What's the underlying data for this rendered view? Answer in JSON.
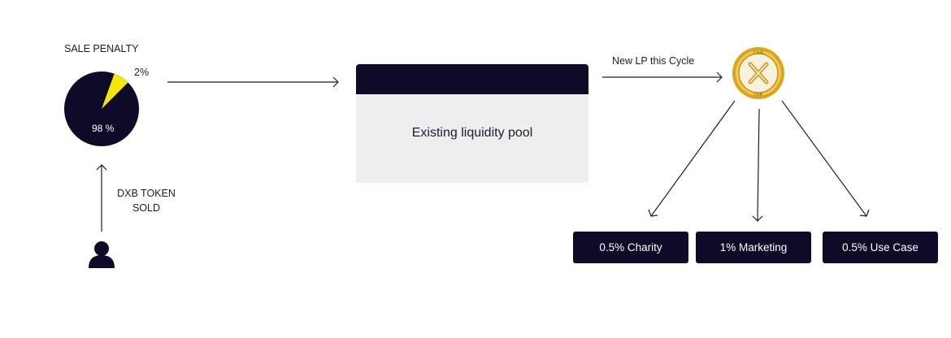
{
  "penalty": {
    "title": "SALE PENALTY",
    "slices": [
      {
        "label": "98 %",
        "value": 98,
        "color": "#0d0b27"
      },
      {
        "label": "2%",
        "value": 2,
        "color": "#f5e60a"
      }
    ]
  },
  "user": {
    "action_line1": "DXB TOKEN",
    "action_line2": "SOLD",
    "icon": "user-icon"
  },
  "pool": {
    "label": "Existing liquidity pool",
    "header_color": "#0d0b27",
    "body_color": "#eeeeee"
  },
  "lp": {
    "label": "New LP this Cycle",
    "coin_icon": "dxb-coin-logo",
    "coin_text": "DXB"
  },
  "allocations": [
    {
      "label": "0.5% Charity"
    },
    {
      "label": "1% Marketing"
    },
    {
      "label": "0.5% Use Case"
    }
  ],
  "colors": {
    "dark": "#0d0b27",
    "accent_yellow": "#f5e60a",
    "gold": "#d9a521"
  }
}
